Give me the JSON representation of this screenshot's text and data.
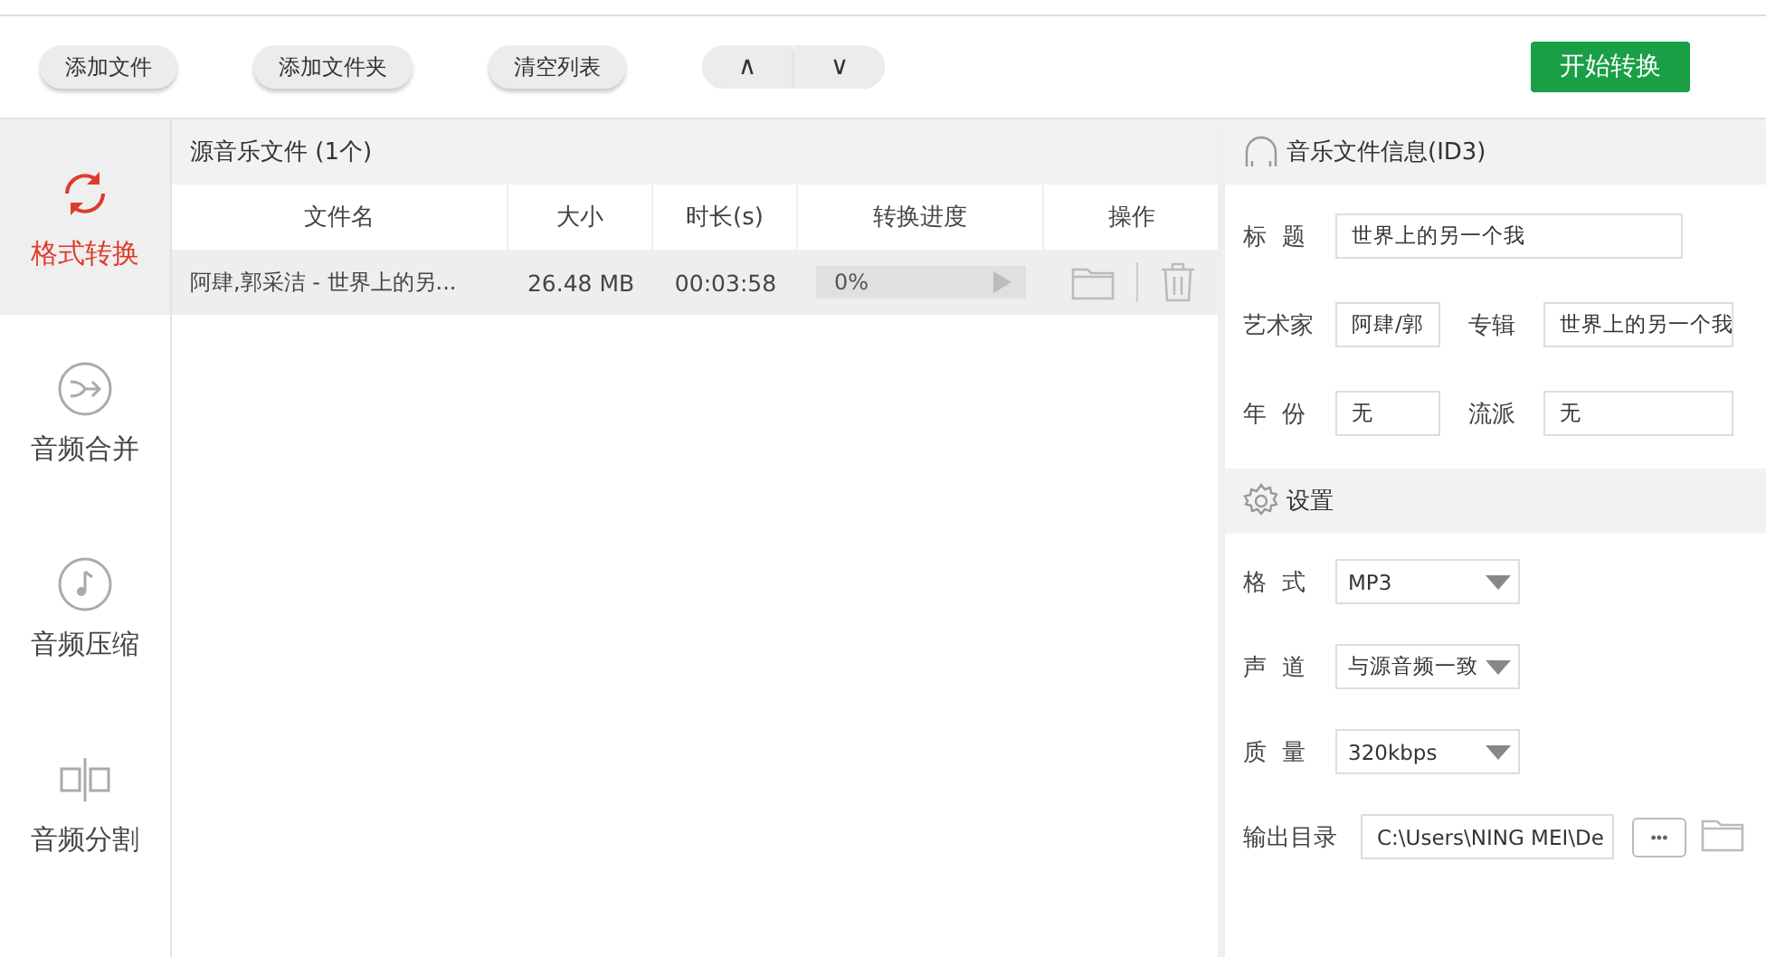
{
  "toolbar": {
    "buttons": [
      "添加文件",
      "添加文件夹",
      "清空列表"
    ],
    "move_up": "∧",
    "move_down": "∨",
    "start_button": "开始转换"
  },
  "sidebar": {
    "items": [
      {
        "label": "格式转换",
        "kind": "convert",
        "selected": true
      },
      {
        "label": "音频合并",
        "kind": "merge",
        "selected": false
      },
      {
        "label": "音频压缩",
        "kind": "compress",
        "selected": false
      },
      {
        "label": "音频分割",
        "kind": "split",
        "selected": false
      }
    ]
  },
  "file_panel": {
    "title": "源音乐文件 (1个)",
    "columns": [
      "文件名",
      "大小",
      "时长(s)",
      "转换进度",
      "操作"
    ],
    "rows": [
      {
        "name": "阿肆,郭采洁 - 世界上的另...",
        "size": "26.48 MB",
        "duration": "00:03:58",
        "progress": "0%",
        "level": 0
      }
    ]
  },
  "id3_panel": {
    "title": "音乐文件信息(ID3)",
    "rows": [
      [
        {
          "label": "标  题",
          "value": "世界上的另一个我"
        }
      ],
      [
        {
          "label": "艺术家",
          "value": "阿肆/郭"
        },
        {
          "label": "专辑",
          "value": "世界上的另一个我"
        }
      ],
      [
        {
          "label": "年  份",
          "value": "无"
        },
        {
          "label": "流派",
          "value": "无"
        }
      ]
    ]
  },
  "settings_panel": {
    "title": "设置",
    "selects": [
      {
        "label": "格  式",
        "value": "MP3"
      },
      {
        "label": "声  道",
        "value": "与源音频一致"
      },
      {
        "label": "质  量",
        "value": "320kbps"
      }
    ],
    "output": {
      "label": "输出目录",
      "value": "C:\\Users\\NING MEI\\De",
      "browse": "•••"
    }
  }
}
